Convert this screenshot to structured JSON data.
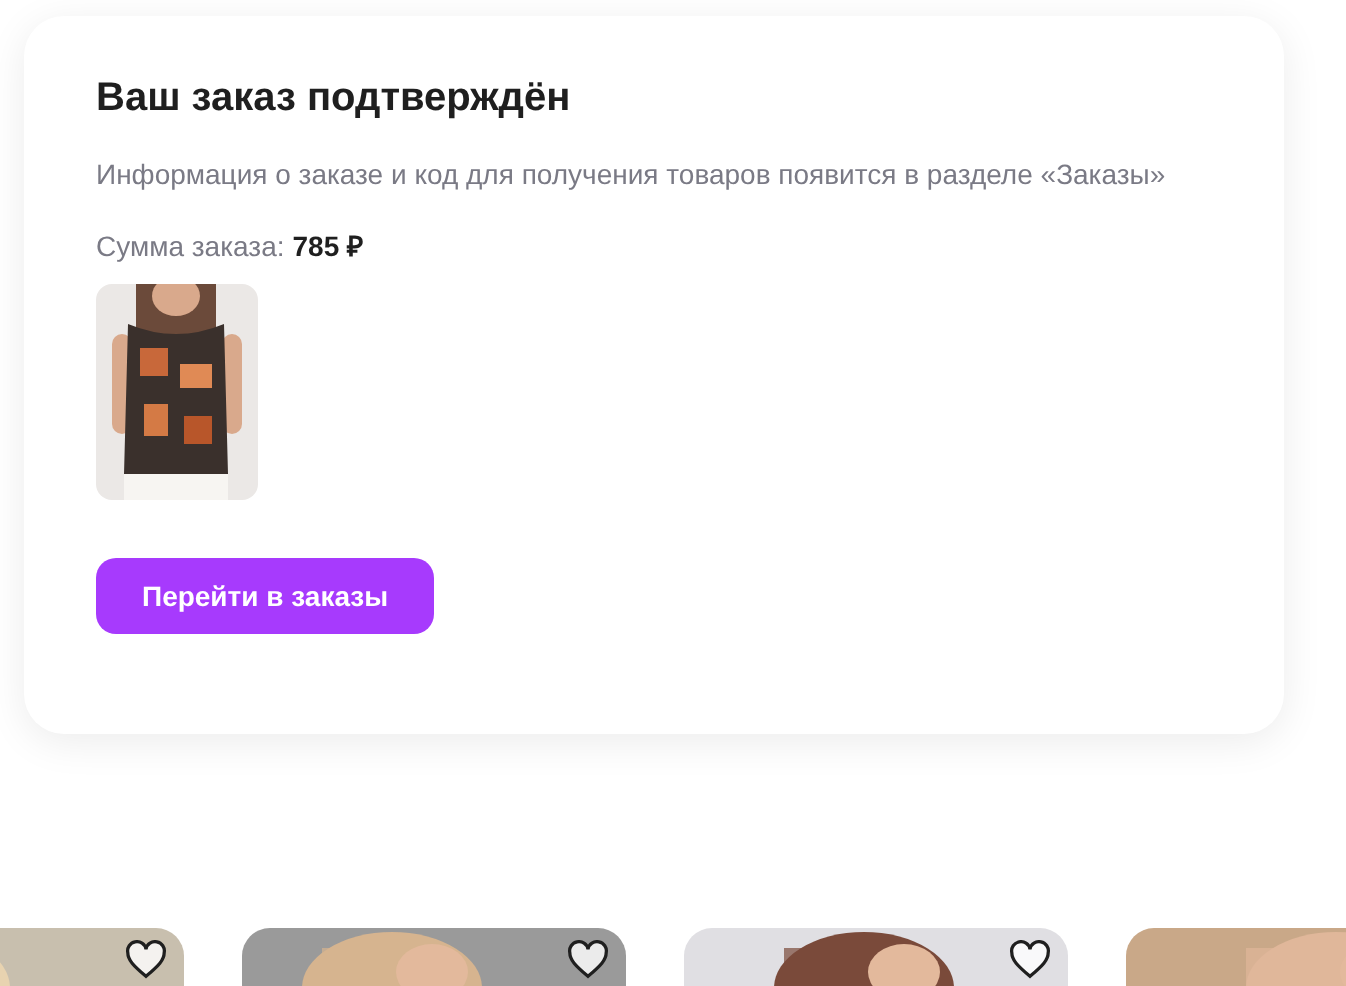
{
  "order_card": {
    "title": "Ваш заказ подтверждён",
    "info": "Информация о заказе и код для получения товаров появится в разделе «Заказы»",
    "sum_label": "Сумма заказа:",
    "sum_value": "785 ₽",
    "button": "Перейти в заказы"
  }
}
